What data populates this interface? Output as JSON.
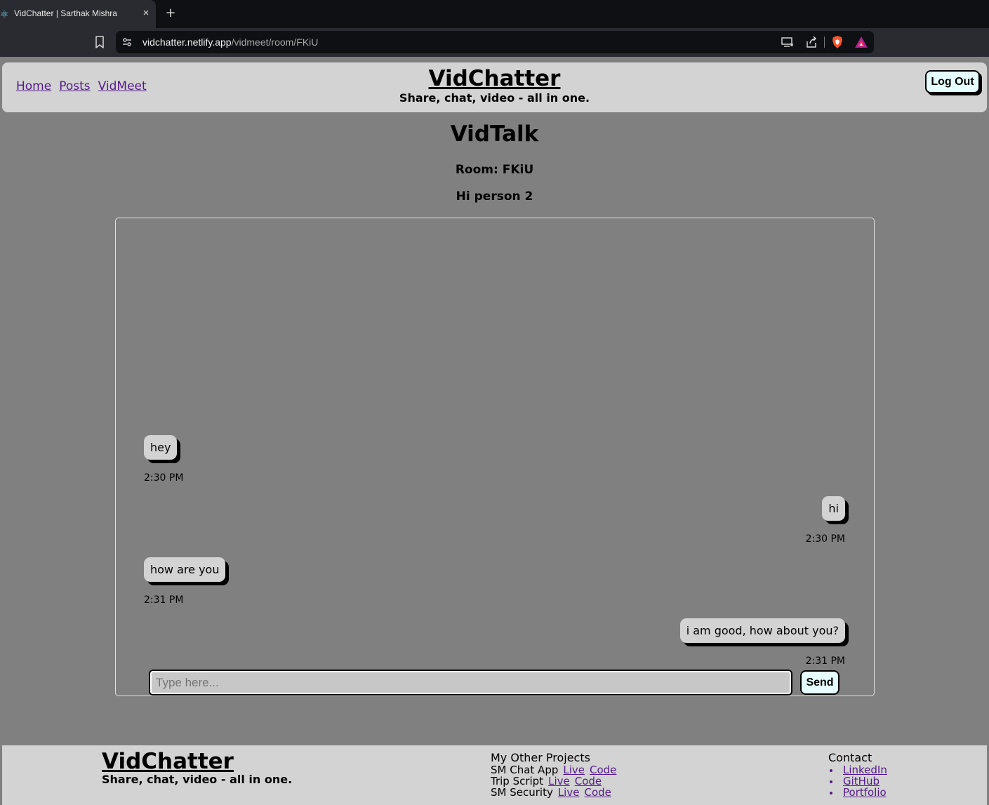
{
  "browser": {
    "tab_title": "VidChatter | Sarthak Mishra",
    "tab_close": "×",
    "new_tab": "+",
    "url_host": "vidchatter.netlify.app",
    "url_path": "/vidmeet/room/FKiU"
  },
  "header": {
    "nav": [
      "Home",
      "Posts",
      "VidMeet"
    ],
    "brand_title": "VidChatter",
    "brand_tagline": "Share, chat, video - all in one.",
    "logout_label": "Log Out"
  },
  "main": {
    "title": "VidTalk",
    "room": "Room: FKiU",
    "greeting": "Hi person 2"
  },
  "messages": [
    {
      "text": "hey",
      "time": "2:30 PM",
      "side": "left"
    },
    {
      "text": "hi",
      "time": "2:30 PM",
      "side": "right"
    },
    {
      "text": "how are you",
      "time": "2:31 PM",
      "side": "left"
    },
    {
      "text": "i am good, how about you?",
      "time": "2:31 PM",
      "side": "right"
    }
  ],
  "composer": {
    "placeholder": "Type here...",
    "value": "",
    "send_label": "Send"
  },
  "footer": {
    "brand_title": "VidChatter",
    "brand_tagline": "Share, chat, video - all in one.",
    "projects_heading": "My Other Projects",
    "projects": [
      {
        "name": "SM Chat App",
        "live": "Live",
        "code": "Code"
      },
      {
        "name": "Trip Script",
        "live": "Live",
        "code": "Code"
      },
      {
        "name": "SM Security",
        "live": "Live",
        "code": "Code"
      }
    ],
    "contact_heading": "Contact",
    "contacts": [
      "LinkedIn",
      "GitHub",
      "Portfolio"
    ]
  },
  "colors": {
    "page_bg": "#808080",
    "panel_bg": "#d3d3d3",
    "link": "#551a8b",
    "button_bg": "#e6feff"
  }
}
